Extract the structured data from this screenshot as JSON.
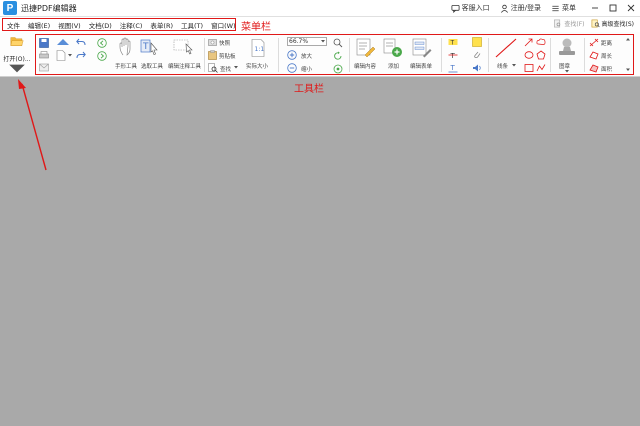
{
  "window": {
    "title": "迅捷PDF编辑器",
    "logo_letter": "P",
    "links": {
      "service": "客服入口",
      "login": "注册/登录",
      "menu": "菜单"
    }
  },
  "menubar": {
    "items": [
      "文件",
      "编辑(E)",
      "视图(V)",
      "文档(D)",
      "注释(C)",
      "表单(R)",
      "工具(T)",
      "窗口(W)"
    ],
    "annotation": "菜单栏",
    "search": "查找(F)",
    "advanced_search": "高级查找(S)"
  },
  "toolbar": {
    "open_label": "打开(O)...",
    "annotation": "工具栏",
    "hand_tool": "手形工具",
    "select_tool": "选取工具",
    "edit_annotation_tool": "编辑注释工具",
    "snapshot": "快照",
    "clipboard": "剪贴板",
    "find": "查找",
    "actual_size": "实际大小",
    "zoom_value": "66.7%",
    "zoom_in": "放大",
    "zoom_out": "缩小",
    "edit_content": "编辑内容",
    "add": "添加",
    "edit_form": "编辑表单",
    "lines": "线条",
    "stamp": "图章",
    "distance": "距离",
    "perimeter": "周长",
    "area": "面积"
  },
  "colors": {
    "annotation_red": "#e01818",
    "brand_blue": "#2a8fe0",
    "workspace_gray": "#a9a9a9"
  }
}
